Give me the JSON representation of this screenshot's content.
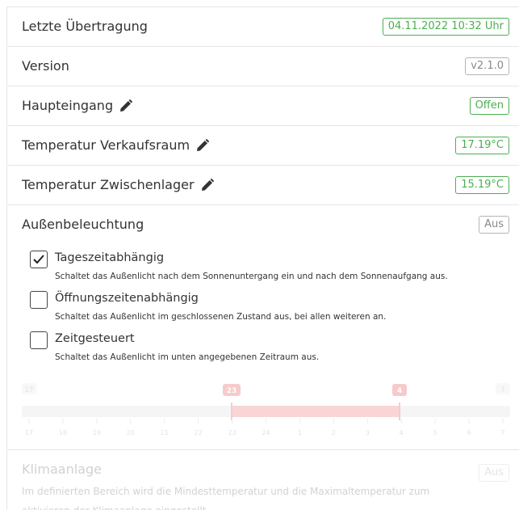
{
  "rows": [
    {
      "label": "Letzte Übertragung",
      "value": "04.11.2022 10:32 Uhr",
      "style": "green",
      "editable": false
    },
    {
      "label": "Version",
      "value": "v2.1.0",
      "style": "grey",
      "editable": false
    },
    {
      "label": "Haupteingang",
      "value": "Offen",
      "style": "green",
      "editable": true
    },
    {
      "label": "Temperatur Verkaufsraum",
      "value": "17.19°C",
      "style": "green",
      "editable": true
    },
    {
      "label": "Temperatur Zwischenlager",
      "value": "15.19°C",
      "style": "green",
      "editable": true
    }
  ],
  "lighting": {
    "title": "Außenbeleuchtung",
    "status": "Aus",
    "options": [
      {
        "title": "Tageszeitabhängig",
        "desc": "Schaltet das Außenlicht nach dem Sonnenuntergang ein und nach dem Sonnenaufgang aus.",
        "checked": true
      },
      {
        "title": "Öffnungszeitenabhängig",
        "desc": "Schaltet das Außenlicht im geschlossenen Zustand aus, bei allen weiteren an.",
        "checked": false
      },
      {
        "title": "Zeitgesteuert",
        "desc": "Schaltet das Außenlicht im unten angegebenen Zeitraum aus.",
        "checked": false
      }
    ],
    "slider": {
      "min_label": "17",
      "max_label": "7",
      "start_label": "23",
      "end_label": "4",
      "start_value": 23,
      "end_value": 4,
      "ticks": [
        "17",
        "18",
        "19",
        "20",
        "21",
        "22",
        "23",
        "24",
        "1",
        "2",
        "3",
        "4",
        "5",
        "6",
        "7"
      ]
    }
  },
  "climate": {
    "title": "Klimaanlage",
    "status": "Aus",
    "desc": "Im definierten Bereich wird die Mindesttemperatur und die Maximaltemperatur zum aktivieren der Klimaanlage eingestellt."
  },
  "colors": {
    "green": "#4caf50",
    "grey": "#8a8a8a",
    "slider_red": "#f06a6a"
  }
}
